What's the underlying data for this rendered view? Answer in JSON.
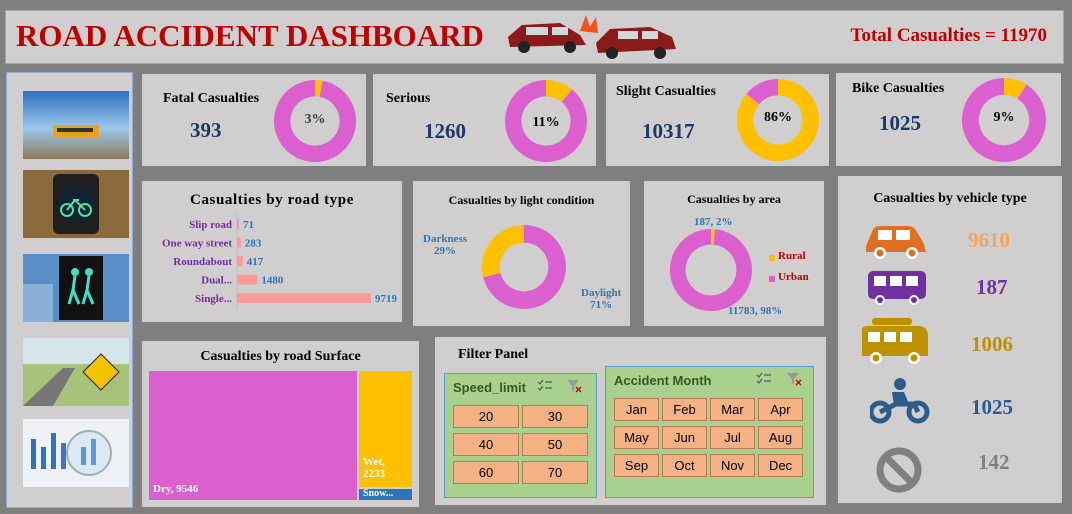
{
  "header": {
    "title": "ROAD ACCIDENT DASHBOARD",
    "total": "Total Casualties = 11970"
  },
  "kpis": [
    {
      "label": "Fatal Casualties",
      "value": "393",
      "pct": "3%",
      "fraction": 0.03
    },
    {
      "label": "Serious",
      "value": "1260",
      "pct": "11%",
      "fraction": 0.11
    },
    {
      "label": "Slight Casualties",
      "value": "10317",
      "pct": "86%",
      "fraction": 0.86
    },
    {
      "label": "Bike Casualties",
      "value": "1025",
      "pct": "9%",
      "fraction": 0.09
    }
  ],
  "colors": {
    "pink": "#dc5fd0",
    "gold": "#ffc000",
    "salmon": "#ff9999",
    "navy": "#1f3864",
    "blue": "#2e75b6",
    "purple": "#7030a0",
    "orange": "#e07020"
  },
  "sidebar": {
    "icons": [
      "bus-photo-icon",
      "bicycle-signal-icon",
      "pedestrian-signal-icon",
      "road-sign-icon",
      "chart-magnifier-icon"
    ]
  },
  "road_type": {
    "title": "Casualties by road type",
    "chart_data": {
      "type": "bar",
      "categories": [
        "Slip road",
        "One way street",
        "Roundabout",
        "Dual...",
        "Single..."
      ],
      "values": [
        71,
        283,
        417,
        1480,
        9719
      ]
    }
  },
  "light": {
    "title": "Casualties by light condition",
    "darkness_name": "Darkness",
    "darkness_pct": "29%",
    "daylight_name": "Daylight",
    "daylight_pct": "71%",
    "chart_data": {
      "type": "pie",
      "categories": [
        "Darkness",
        "Daylight"
      ],
      "values": [
        29,
        71
      ]
    }
  },
  "area": {
    "title": "Casualties by area",
    "rural_label": "187, 2%",
    "urban_label": "11783, 98%",
    "legend_rural": "Rural",
    "legend_urban": "Urban",
    "chart_data": {
      "type": "pie",
      "categories": [
        "Rural",
        "Urban"
      ],
      "values": [
        187,
        11783
      ]
    }
  },
  "vehicle": {
    "title": "Casualties by vehicle type",
    "items": [
      {
        "icon": "car-icon",
        "value": "9610",
        "color": "#f4a460"
      },
      {
        "icon": "bus-icon",
        "value": "187",
        "color": "#7030a0"
      },
      {
        "icon": "van-icon",
        "value": "1006",
        "color": "#bf9000"
      },
      {
        "icon": "motorbike-icon",
        "value": "1025",
        "color": "#2e5c8a"
      },
      {
        "icon": "no-entry-icon",
        "value": "142",
        "color": "#808080"
      }
    ]
  },
  "surface": {
    "title": "Casualties by road Surface",
    "dry_label": "Dry, 9546",
    "wet_label": "Wet,",
    "wet_value": "2233",
    "snow_label": "Snow...",
    "chart_data": {
      "type": "heatmap",
      "categories": [
        "Dry",
        "Wet",
        "Snow"
      ],
      "values": [
        9546,
        2233
      ]
    }
  },
  "filter": {
    "title": "Filter Panel",
    "speed": {
      "title": "Speed_limit",
      "options": [
        "20",
        "30",
        "40",
        "50",
        "60",
        "70"
      ]
    },
    "month": {
      "title": "Accident Month",
      "options": [
        "Jan",
        "Feb",
        "Mar",
        "Apr",
        "May",
        "Jun",
        "Jul",
        "Aug",
        "Sep",
        "Oct",
        "Nov",
        "Dec"
      ]
    }
  }
}
